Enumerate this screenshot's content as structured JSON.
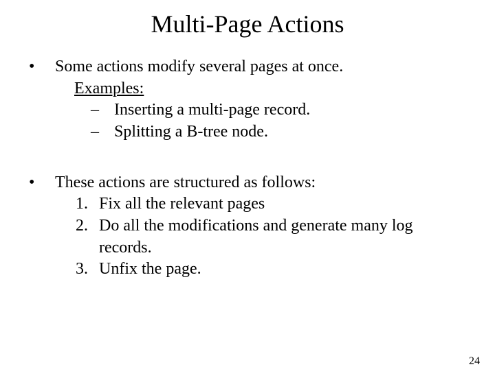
{
  "title": "Multi-Page Actions",
  "bullets": [
    {
      "dot": "•",
      "text": "Some actions modify several pages at once.",
      "examples_label": "Examples:",
      "subitems": [
        {
          "dash": "–",
          "text": "Inserting a multi-page record."
        },
        {
          "dash": "–",
          "text": "Splitting a B-tree node."
        }
      ]
    },
    {
      "dot": "•",
      "text": "These actions are structured as follows:",
      "numitems": [
        {
          "num": "1.",
          "text": "Fix all the relevant pages"
        },
        {
          "num": "2.",
          "text": "Do all the modifications and generate many log records."
        },
        {
          "num": "3.",
          "text": "Unfix the page."
        }
      ]
    }
  ],
  "page_number": "24"
}
